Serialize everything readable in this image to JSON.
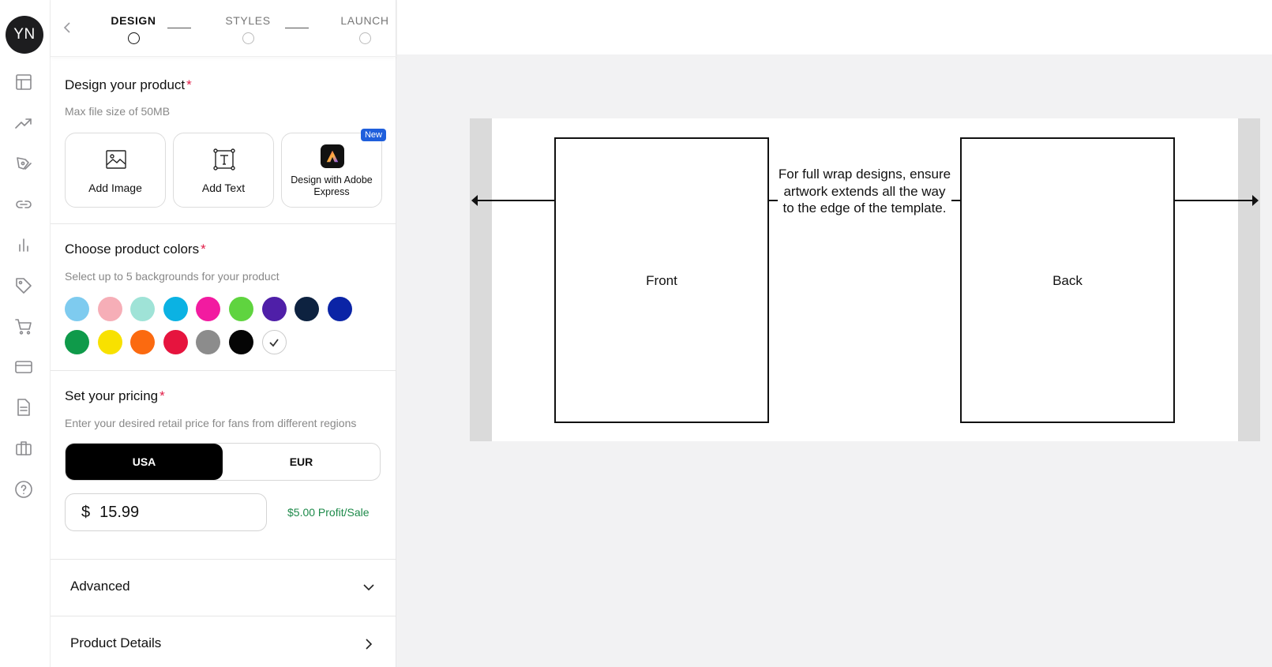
{
  "user": {
    "initials": "YN"
  },
  "rail": {
    "icons": [
      "layout-icon",
      "trending-icon",
      "pen-tool-icon",
      "link-icon",
      "bar-chart-icon",
      "tag-icon",
      "cart-icon",
      "credit-card-icon",
      "document-icon",
      "briefcase-icon",
      "help-icon"
    ]
  },
  "stepper": {
    "steps": [
      {
        "label": "DESIGN",
        "active": true
      },
      {
        "label": "STYLES",
        "active": false
      },
      {
        "label": "LAUNCH",
        "active": false
      }
    ]
  },
  "design": {
    "title": "Design your product",
    "required_mark": "*",
    "subtitle": "Max file size of 50MB",
    "tools": [
      {
        "label": "Add Image",
        "icon": "image-icon"
      },
      {
        "label": "Add Text",
        "icon": "text-box-icon"
      },
      {
        "label": "Design with Adobe Express",
        "icon": "adobe-express-icon",
        "badge": "New"
      }
    ]
  },
  "colors": {
    "title": "Choose product colors",
    "required_mark": "*",
    "subtitle": "Select up to 5 backgrounds for your product",
    "swatches": [
      "#7ecbef",
      "#f6aeb7",
      "#9fe3d7",
      "#0bb2e3",
      "#f21ba0",
      "#5fd43f",
      "#4f1fa8",
      "#0d2240",
      "#0b24a6",
      "#0f9a4a",
      "#f8e100",
      "#fb6a10",
      "#e6143e",
      "#8c8c8c",
      "#050505",
      "#ffffff"
    ],
    "selected": [
      "#ffffff"
    ]
  },
  "pricing": {
    "title": "Set your pricing",
    "required_mark": "*",
    "subtitle": "Enter your desired retail price for fans from different regions",
    "regions": [
      "USA",
      "EUR"
    ],
    "active_region": "USA",
    "currency_symbol": "$",
    "price": "15.99",
    "profit": "$5.00 Profit/Sale"
  },
  "accordions": [
    {
      "label": "Advanced",
      "icon": "chevron-down-icon"
    },
    {
      "label": "Product Details",
      "icon": "chevron-right-icon"
    }
  ],
  "template": {
    "front_label": "Front",
    "back_label": "Back",
    "wrap_note": "For full wrap designs, ensure artwork extends all the way to the edge of the template."
  }
}
